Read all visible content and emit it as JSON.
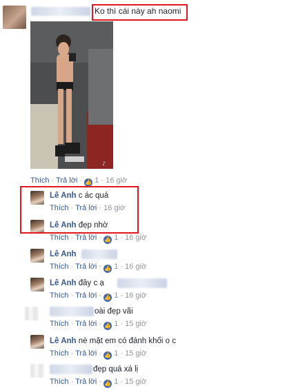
{
  "main_comment": {
    "text": "Ko thì cái này ah naomi",
    "actions": {
      "like": "Thích",
      "separator": "·",
      "reply": "Trả lời",
      "like_count": "1",
      "time": "16 giờ"
    }
  },
  "replies": [
    {
      "name": "Lê Anh",
      "text": "c ác quá",
      "like": "Thích",
      "reply": "Trả lời",
      "like_count": "",
      "time": "16 giờ"
    },
    {
      "name": "Lê Anh",
      "text": "đẹp nhờ",
      "like": "Thích",
      "reply": "Trả lời",
      "like_count": "1",
      "time": "16 giờ"
    },
    {
      "name": "Lê Anh",
      "text": "",
      "like": "Thích",
      "reply": "Trả lời",
      "like_count": "1",
      "time": "16 giờ"
    },
    {
      "name": "Lê Anh",
      "text": "đây c ạ",
      "like": "Thích",
      "reply": "Trả lời",
      "like_count": "1",
      "time": "16 giờ"
    },
    {
      "name": "",
      "text": "oài đẹp vãi",
      "like": "Thích",
      "reply": "Trả lời",
      "like_count": "1",
      "time": "15 giờ"
    },
    {
      "name": "Lê Anh",
      "text": "nè mặt em có đánh khối o c",
      "like": "Thích",
      "reply": "Trả lời",
      "like_count": "1",
      "time": "15 giờ"
    },
    {
      "name": "",
      "text": "đẹp quá xá lị",
      "like": "Thích",
      "reply": "Trả lời",
      "like_count": "1",
      "time": "15 giờ"
    }
  ],
  "icons": {
    "like": "thumbs-up-icon"
  },
  "colors": {
    "link": "#365899",
    "muted": "#90949c",
    "highlight": "#e2171d"
  }
}
